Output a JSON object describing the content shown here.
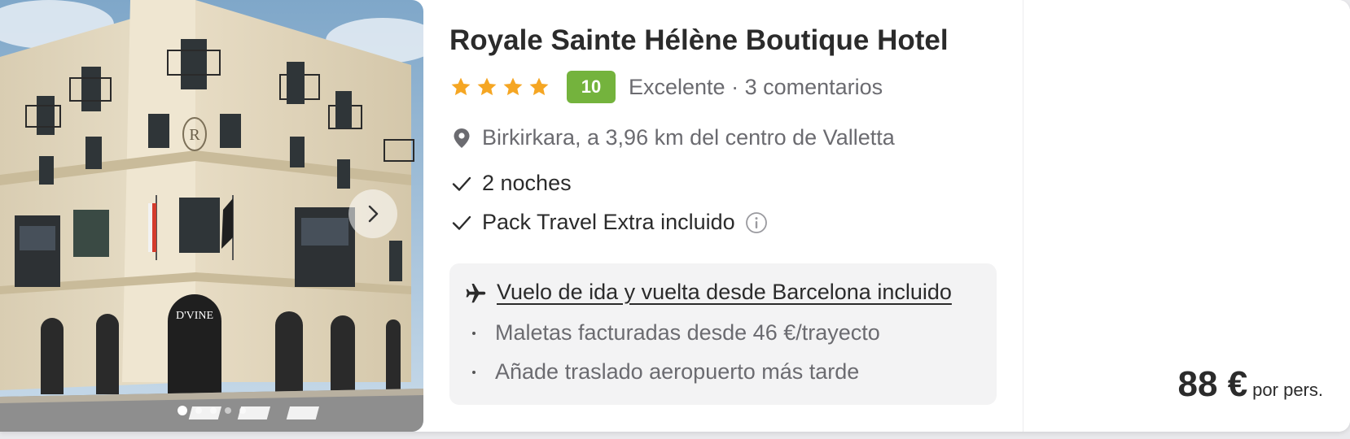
{
  "hotel": {
    "name": "Royale Sainte Hélène Boutique Hotel",
    "star_rating": 4,
    "score": "10",
    "rating_text": "Excelente · 3 comentarios",
    "location": "Birkirkara, a 3,96 km del centro de Valletta"
  },
  "photo": {
    "building_sign": "D'VINE",
    "monogram": "R",
    "slide_count": 5,
    "active_slide": 1,
    "next_icon": "chevron-right-icon"
  },
  "features": [
    {
      "label": "2 noches",
      "icon": "check-icon"
    },
    {
      "label": "Pack Travel Extra incluido",
      "icon": "check-icon"
    }
  ],
  "flight": {
    "title": "Vuelo de ida y vuelta desde Barcelona incluido",
    "icon": "airplane-icon",
    "notes": [
      "Maletas facturadas desde 46 €/trayecto",
      "Añade traslado aeropuerto más tarde"
    ]
  },
  "price": {
    "amount": "88 €",
    "per": "por pers."
  },
  "colors": {
    "star": "#f5a623",
    "score_badge": "#74b33d",
    "muted_text": "#6b6b70",
    "flight_box": "#f3f3f4"
  }
}
